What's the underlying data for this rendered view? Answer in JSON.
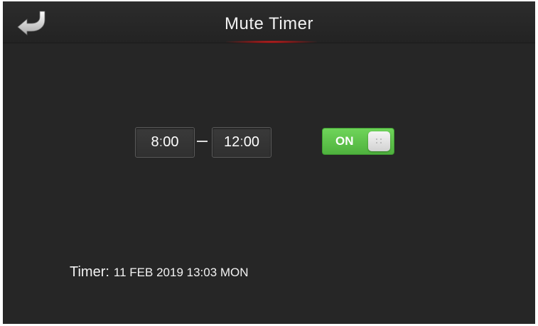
{
  "header": {
    "title": "Mute Timer",
    "back_icon": "back-arrow-icon"
  },
  "schedule": {
    "start_hour": "8",
    "start_minute": "00",
    "end_hour": "12",
    "end_minute": "00",
    "separator": ":"
  },
  "toggle": {
    "label": "ON",
    "state": "on",
    "color": "#5cc24a"
  },
  "status": {
    "label": "Timer:",
    "value": "11 FEB 2019 13:03 MON"
  },
  "colors": {
    "background": "#262626",
    "accent_red": "#e02020",
    "toggle_green": "#5cc24a"
  }
}
